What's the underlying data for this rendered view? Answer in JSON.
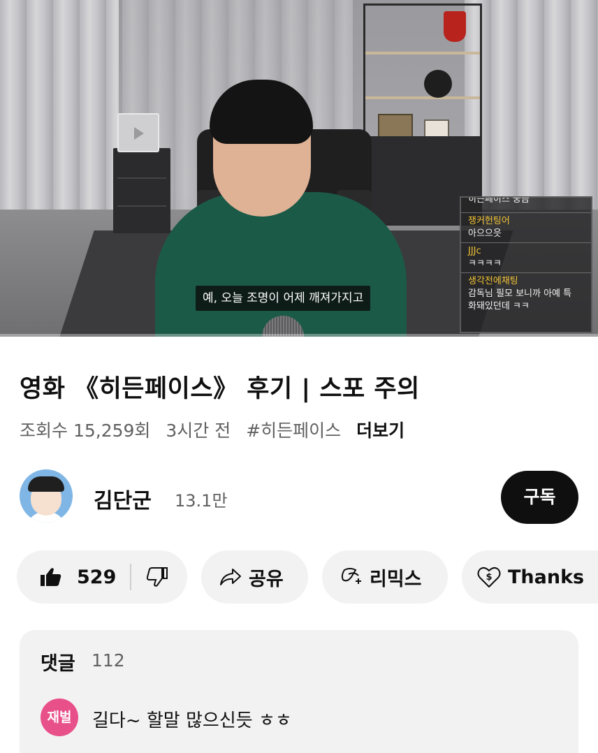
{
  "video": {
    "subtitle": "예, 오늘 조명이 어제 깨져가지고",
    "chat": [
      {
        "nick": "",
        "msg": "히든페이스 궁금"
      },
      {
        "nick": "쟁커헌팅어",
        "msg": "아으으읏"
      },
      {
        "nick": "JJJc",
        "msg": "ㅋㅋㅋㅋ"
      },
      {
        "nick": "생각전에채팅",
        "msg": "감독님 필모 보니까 아예 특",
        "msg2": "화돼있던데 ㅋㅋ"
      }
    ]
  },
  "title": "영화 《히든페이스》 후기 | 스포 주의",
  "meta": {
    "views": "조회수 15,259회",
    "age": "3시간 전",
    "hashtag": "#히든페이스",
    "more": "더보기"
  },
  "channel": {
    "name": "김단군",
    "subscribers": "13.1만",
    "subscribe_label": "구독"
  },
  "actions": {
    "like_count": "529",
    "share_label": "공유",
    "remix_label": "리믹스",
    "thanks_label": "Thanks"
  },
  "comments": {
    "label": "댓글",
    "count": "112",
    "first": {
      "avatar_text": "재벌",
      "text": "길다~ 할말 많으신듯 ㅎㅎ"
    }
  },
  "colors": {
    "subscribe_bg": "#0f0f0f",
    "pill_bg": "#f2f2f2",
    "chat_nick": "#f2c334",
    "comment_avatar": "#e8508a"
  },
  "icons": [
    "thumb-up-icon",
    "thumb-down-icon",
    "share-arrow-icon",
    "remix-icon",
    "thanks-heart-dollar-icon"
  ]
}
